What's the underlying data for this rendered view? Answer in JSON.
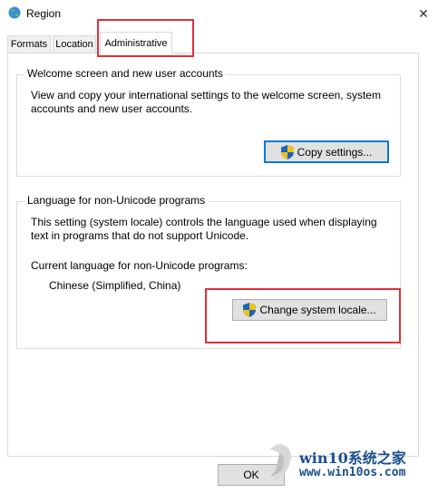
{
  "window": {
    "title": "Region",
    "close_glyph": "✕"
  },
  "tabs": [
    {
      "label": "Formats"
    },
    {
      "label": "Location"
    },
    {
      "label": "Administrative"
    }
  ],
  "welcome_group": {
    "legend": "Welcome screen and new user accounts",
    "description_line1": "View and copy your international settings to the welcome screen, system",
    "description_line2": "accounts and new user accounts.",
    "button_label": "Copy settings..."
  },
  "nonunicode_group": {
    "legend": "Language for non-Unicode programs",
    "description_line1": "This setting (system locale) controls the language used when displaying",
    "description_line2": "text in programs that do not support Unicode.",
    "current_label": "Current language for non-Unicode programs:",
    "current_value": "Chinese (Simplified, China)",
    "button_label": "Change system locale..."
  },
  "footer": {
    "ok_label": "OK"
  },
  "watermark": {
    "title": "win10系统之家",
    "url": "www.win10os.com"
  },
  "colors": {
    "highlight": "#e0303a",
    "focus_border": "#0078d7",
    "watermark_text": "#1b4f8c"
  },
  "icons": {
    "app": "globe-icon",
    "close": "close-icon",
    "uac": "uac-shield-icon"
  }
}
